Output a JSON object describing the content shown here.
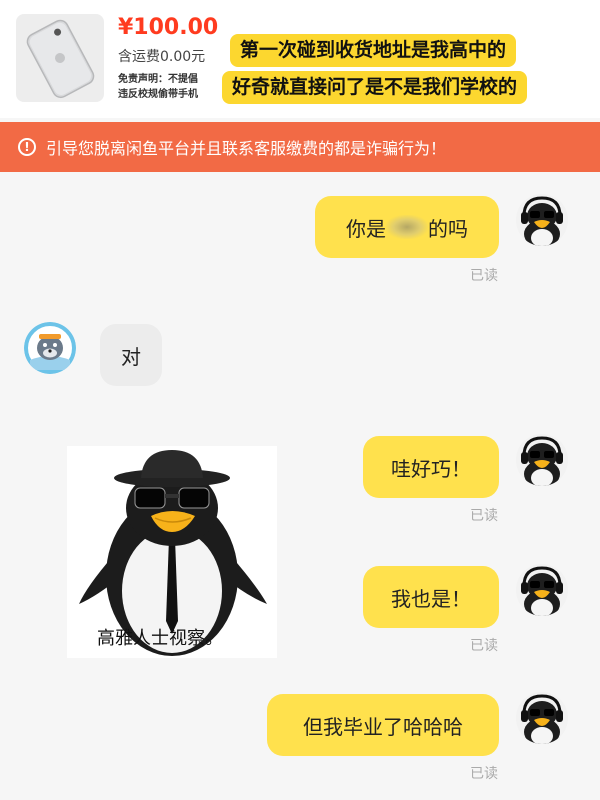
{
  "product": {
    "price": "¥100.00",
    "shipping": "含运费0.00元",
    "disclaimer_line1": "免责声明：不提倡",
    "disclaimer_line2": "违反校规偷带手机",
    "thumbnail_icon": "phone-icon"
  },
  "caption": {
    "line1": "第一次碰到收货地址是我高中的",
    "line2": "好奇就直接问了是不是我们学校的"
  },
  "warning": {
    "icon": "alert-icon",
    "text": "引导您脱离闲鱼平台并且联系客服缴费的都是诈骗行为！"
  },
  "messages": [
    {
      "sender": "me",
      "prefix": "你是",
      "suffix": "的吗",
      "read": "已读"
    },
    {
      "sender": "them",
      "text": "对"
    },
    {
      "sender": "them",
      "type": "sticker",
      "caption": "高雅人士视察。"
    },
    {
      "sender": "me",
      "text": "哇好巧！",
      "read": "已读"
    },
    {
      "sender": "me",
      "text": "我也是！",
      "read": "已读"
    },
    {
      "sender": "me",
      "text": "但我毕业了哈哈哈",
      "read": "已读"
    }
  ],
  "colors": {
    "price": "#ff3b1f",
    "caption_highlight": "#fcd72f",
    "warning_bg": "#f26a45",
    "my_bubble": "#ffe14d",
    "their_bubble": "#ececec"
  }
}
